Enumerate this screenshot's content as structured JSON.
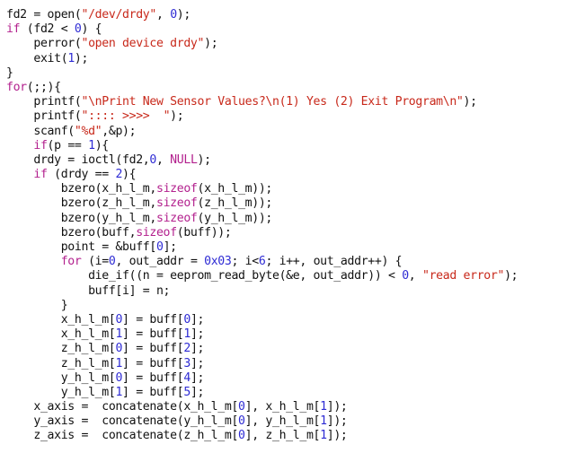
{
  "theme": {
    "background": "#ffffff",
    "colors": {
      "default": "#111111",
      "keyword": "#b3218e",
      "string": "#c8291b",
      "number": "#2e2bd4"
    }
  },
  "code": {
    "lines": [
      [
        {
          "t": "fd2 = open(",
          "c": "d"
        },
        {
          "t": "\"/dev/drdy\"",
          "c": "s"
        },
        {
          "t": ", ",
          "c": "d"
        },
        {
          "t": "0",
          "c": "n"
        },
        {
          "t": ");",
          "c": "d"
        }
      ],
      [
        {
          "t": "if",
          "c": "k"
        },
        {
          "t": " (fd2 < ",
          "c": "d"
        },
        {
          "t": "0",
          "c": "n"
        },
        {
          "t": ") {",
          "c": "d"
        }
      ],
      [
        {
          "t": "    perror(",
          "c": "d"
        },
        {
          "t": "\"open device drdy\"",
          "c": "s"
        },
        {
          "t": ");",
          "c": "d"
        }
      ],
      [
        {
          "t": "    exit(",
          "c": "d"
        },
        {
          "t": "1",
          "c": "n"
        },
        {
          "t": ");",
          "c": "d"
        }
      ],
      [
        {
          "t": "}",
          "c": "d"
        }
      ],
      [
        {
          "t": "for",
          "c": "k"
        },
        {
          "t": "(;;){",
          "c": "d"
        }
      ],
      [
        {
          "t": "    printf(",
          "c": "d"
        },
        {
          "t": "\"\\nPrint New Sensor Values?\\n(1) Yes (2) Exit Program\\n\"",
          "c": "s"
        },
        {
          "t": ");",
          "c": "d"
        }
      ],
      [
        {
          "t": "    printf(",
          "c": "d"
        },
        {
          "t": "\":::: >>>>  \"",
          "c": "s"
        },
        {
          "t": ");",
          "c": "d"
        }
      ],
      [
        {
          "t": "    scanf(",
          "c": "d"
        },
        {
          "t": "\"%d\"",
          "c": "s"
        },
        {
          "t": ",&p);",
          "c": "d"
        }
      ],
      [
        {
          "t": "    ",
          "c": "d"
        },
        {
          "t": "if",
          "c": "k"
        },
        {
          "t": "(p == ",
          "c": "d"
        },
        {
          "t": "1",
          "c": "n"
        },
        {
          "t": "){",
          "c": "d"
        }
      ],
      [
        {
          "t": "    drdy = ioctl(fd2,",
          "c": "d"
        },
        {
          "t": "0",
          "c": "n"
        },
        {
          "t": ", ",
          "c": "d"
        },
        {
          "t": "NULL",
          "c": "k"
        },
        {
          "t": ");",
          "c": "d"
        }
      ],
      [
        {
          "t": "    ",
          "c": "d"
        },
        {
          "t": "if",
          "c": "k"
        },
        {
          "t": " (drdy == ",
          "c": "d"
        },
        {
          "t": "2",
          "c": "n"
        },
        {
          "t": "){",
          "c": "d"
        }
      ],
      [
        {
          "t": "        bzero(x_h_l_m,",
          "c": "d"
        },
        {
          "t": "sizeof",
          "c": "k"
        },
        {
          "t": "(x_h_l_m));",
          "c": "d"
        }
      ],
      [
        {
          "t": "        bzero(z_h_l_m,",
          "c": "d"
        },
        {
          "t": "sizeof",
          "c": "k"
        },
        {
          "t": "(z_h_l_m));",
          "c": "d"
        }
      ],
      [
        {
          "t": "        bzero(y_h_l_m,",
          "c": "d"
        },
        {
          "t": "sizeof",
          "c": "k"
        },
        {
          "t": "(y_h_l_m));",
          "c": "d"
        }
      ],
      [
        {
          "t": "        bzero(buff,",
          "c": "d"
        },
        {
          "t": "sizeof",
          "c": "k"
        },
        {
          "t": "(buff));",
          "c": "d"
        }
      ],
      [
        {
          "t": "        point = &buff[",
          "c": "d"
        },
        {
          "t": "0",
          "c": "n"
        },
        {
          "t": "];",
          "c": "d"
        }
      ],
      [
        {
          "t": "        ",
          "c": "d"
        },
        {
          "t": "for",
          "c": "k"
        },
        {
          "t": " (i=",
          "c": "d"
        },
        {
          "t": "0",
          "c": "n"
        },
        {
          "t": ", out_addr = ",
          "c": "d"
        },
        {
          "t": "0x03",
          "c": "n"
        },
        {
          "t": "; i<",
          "c": "d"
        },
        {
          "t": "6",
          "c": "n"
        },
        {
          "t": "; i++, out_addr++) {",
          "c": "d"
        }
      ],
      [
        {
          "t": "            die_if((n = eeprom_read_byte(&e, out_addr)) < ",
          "c": "d"
        },
        {
          "t": "0",
          "c": "n"
        },
        {
          "t": ", ",
          "c": "d"
        },
        {
          "t": "\"read error\"",
          "c": "s"
        },
        {
          "t": ");",
          "c": "d"
        }
      ],
      [
        {
          "t": "            buff[i] = n;",
          "c": "d"
        }
      ],
      [
        {
          "t": "        }",
          "c": "d"
        }
      ],
      [
        {
          "t": "        x_h_l_m[",
          "c": "d"
        },
        {
          "t": "0",
          "c": "n"
        },
        {
          "t": "] = buff[",
          "c": "d"
        },
        {
          "t": "0",
          "c": "n"
        },
        {
          "t": "];",
          "c": "d"
        }
      ],
      [
        {
          "t": "        x_h_l_m[",
          "c": "d"
        },
        {
          "t": "1",
          "c": "n"
        },
        {
          "t": "] = buff[",
          "c": "d"
        },
        {
          "t": "1",
          "c": "n"
        },
        {
          "t": "];",
          "c": "d"
        }
      ],
      [
        {
          "t": "        z_h_l_m[",
          "c": "d"
        },
        {
          "t": "0",
          "c": "n"
        },
        {
          "t": "] = buff[",
          "c": "d"
        },
        {
          "t": "2",
          "c": "n"
        },
        {
          "t": "];",
          "c": "d"
        }
      ],
      [
        {
          "t": "        z_h_l_m[",
          "c": "d"
        },
        {
          "t": "1",
          "c": "n"
        },
        {
          "t": "] = buff[",
          "c": "d"
        },
        {
          "t": "3",
          "c": "n"
        },
        {
          "t": "];",
          "c": "d"
        }
      ],
      [
        {
          "t": "        y_h_l_m[",
          "c": "d"
        },
        {
          "t": "0",
          "c": "n"
        },
        {
          "t": "] = buff[",
          "c": "d"
        },
        {
          "t": "4",
          "c": "n"
        },
        {
          "t": "];",
          "c": "d"
        }
      ],
      [
        {
          "t": "        y_h_l_m[",
          "c": "d"
        },
        {
          "t": "1",
          "c": "n"
        },
        {
          "t": "] = buff[",
          "c": "d"
        },
        {
          "t": "5",
          "c": "n"
        },
        {
          "t": "];",
          "c": "d"
        }
      ],
      [
        {
          "t": "    x_axis =  concatenate(x_h_l_m[",
          "c": "d"
        },
        {
          "t": "0",
          "c": "n"
        },
        {
          "t": "], x_h_l_m[",
          "c": "d"
        },
        {
          "t": "1",
          "c": "n"
        },
        {
          "t": "]);",
          "c": "d"
        }
      ],
      [
        {
          "t": "    y_axis =  concatenate(y_h_l_m[",
          "c": "d"
        },
        {
          "t": "0",
          "c": "n"
        },
        {
          "t": "], y_h_l_m[",
          "c": "d"
        },
        {
          "t": "1",
          "c": "n"
        },
        {
          "t": "]);",
          "c": "d"
        }
      ],
      [
        {
          "t": "    z_axis =  concatenate(z_h_l_m[",
          "c": "d"
        },
        {
          "t": "0",
          "c": "n"
        },
        {
          "t": "], z_h_l_m[",
          "c": "d"
        },
        {
          "t": "1",
          "c": "n"
        },
        {
          "t": "]);",
          "c": "d"
        }
      ]
    ]
  }
}
